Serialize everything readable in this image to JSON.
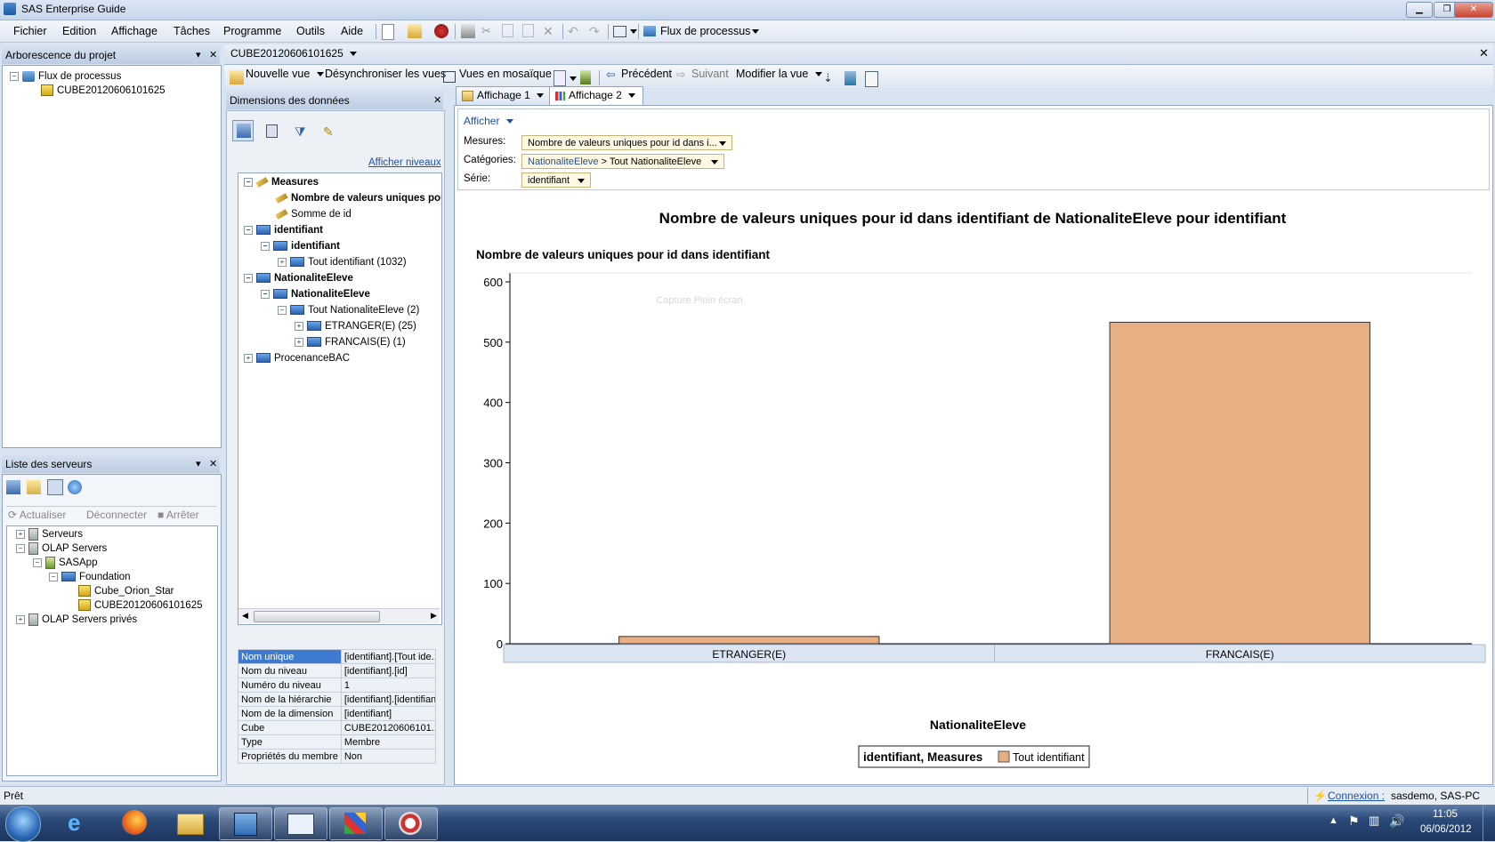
{
  "app": {
    "title": "SAS Enterprise Guide"
  },
  "menubar": {
    "items": [
      "Fichier",
      "Edition",
      "Affichage",
      "Tâches",
      "Programme",
      "Outils",
      "Aide"
    ],
    "process_flow_label": "Flux de processus"
  },
  "project_tree": {
    "header": "Arborescence du projet",
    "items": [
      {
        "label": "Flux de processus",
        "icon": "process-flow-icon"
      },
      {
        "label": "CUBE20120606101625",
        "icon": "cube-icon"
      }
    ]
  },
  "servers": {
    "header": "Liste des serveurs",
    "toolbar": {
      "refresh": "Actualiser",
      "disconnect": "Déconnecter",
      "stop": "Arrêter"
    },
    "items": [
      {
        "label": "Serveurs",
        "icon": "server-icon"
      },
      {
        "label": "OLAP Servers",
        "icon": "olap-server-icon"
      },
      {
        "label": "SASApp",
        "icon": "sasapp-icon"
      },
      {
        "label": "Foundation",
        "icon": "foundation-icon"
      },
      {
        "label": "Cube_Orion_Star",
        "icon": "cube-icon"
      },
      {
        "label": "CUBE20120606101625",
        "icon": "cube-icon"
      },
      {
        "label": "OLAP Servers privés",
        "icon": "olap-server-icon"
      }
    ]
  },
  "document": {
    "tab_title": "CUBE20120606101625"
  },
  "toolbar2": {
    "new_view": "Nouvelle vue",
    "desync": "Désynchroniser les vues",
    "tiled": "Vues en mosaïque",
    "previous": "Précédent",
    "next": "Suivant",
    "modify_view": "Modifier la vue"
  },
  "dimensions": {
    "header": "Dimensions des données",
    "show_levels": "Afficher niveaux",
    "tree": [
      {
        "label": "Measures",
        "bold": true
      },
      {
        "label": "Nombre de valeurs uniques pour id dans identifiant",
        "bold": true
      },
      {
        "label": "Somme de id",
        "bold": false
      },
      {
        "label": "identifiant",
        "bold": true
      },
      {
        "label": "identifiant",
        "bold": true
      },
      {
        "label": "Tout identifiant (1032)",
        "bold": false
      },
      {
        "label": "NationaliteEleve",
        "bold": true
      },
      {
        "label": "NationaliteEleve",
        "bold": true
      },
      {
        "label": "Tout NationaliteEleve (2)",
        "bold": false
      },
      {
        "label": "ETRANGER(E) (25)",
        "bold": false
      },
      {
        "label": "FRANCAIS(E) (1)",
        "bold": false
      },
      {
        "label": "ProcenanceBAC",
        "bold": false
      }
    ],
    "properties": [
      {
        "key": "Nom unique",
        "value": "[identifiant].[Tout ide..."
      },
      {
        "key": "Nom du niveau",
        "value": "[identifiant].[id]"
      },
      {
        "key": "Numéro du niveau",
        "value": "1"
      },
      {
        "key": "Nom de la hiérarchie",
        "value": "[identifiant].[identifiant]"
      },
      {
        "key": "Nom de la dimension",
        "value": "[identifiant]"
      },
      {
        "key": "Cube",
        "value": "CUBE20120606101..."
      },
      {
        "key": "Type",
        "value": "Membre"
      },
      {
        "key": "Propriétés du membre",
        "value": "Non"
      }
    ]
  },
  "view_tabs": [
    "Affichage 1",
    "Affichage 2"
  ],
  "controls": {
    "show": "Afficher",
    "measures_label": "Mesures:",
    "measures_value": "Nombre de valeurs uniques pour id dans i...",
    "categories_label": "Catégories:",
    "categories_value_link": "NationaliteEleve",
    "categories_value_rest": "> Tout NationaliteEleve",
    "series_label": "Série:",
    "series_value": "identifiant"
  },
  "overlay_text": "Capture Plein écran",
  "chart_data": {
    "type": "bar",
    "title": "Nombre de valeurs uniques pour id dans identifiant de NationaliteEleve pour identifiant",
    "ylabel": "Nombre de valeurs uniques pour id dans identifiant",
    "xlabel": "NationaliteEleve",
    "categories": [
      "ETRANGER(E)",
      "FRANCAIS(E)"
    ],
    "series": [
      {
        "name": "Tout identifiant",
        "values": [
          12,
          533
        ]
      }
    ],
    "ylim": [
      0,
      600
    ],
    "yticks": [
      0,
      100,
      200,
      300,
      400,
      500,
      600
    ],
    "legend_title": "identifiant, Measures",
    "legend_placement": "bottom-center",
    "grid": false,
    "bar_color": "#e8af85"
  },
  "status": {
    "left": "Prêt",
    "connection_link": "Connexion :",
    "connection_value": "sasdemo, SAS-PC"
  },
  "taskbar": {
    "time": "11:05",
    "date": "06/06/2012"
  }
}
